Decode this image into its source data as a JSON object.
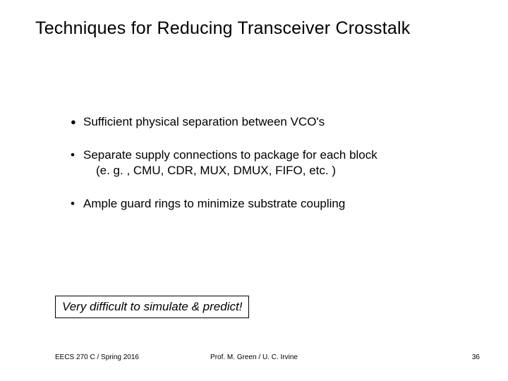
{
  "title": "Techniques for Reducing Transceiver Crosstalk",
  "bullets": {
    "b1": "Sufficient physical separation between VCO's",
    "b2": "Separate supply connections to package for each block",
    "b2_sub": "(e. g. , CMU, CDR, MUX, DMUX, FIFO, etc. )",
    "b3": "Ample guard rings to minimize substrate coupling"
  },
  "note": "Very difficult to simulate & predict!",
  "footer": {
    "left": "EECS 270 C / Spring 2016",
    "center": "Prof. M. Green / U. C. Irvine",
    "right": "36"
  }
}
